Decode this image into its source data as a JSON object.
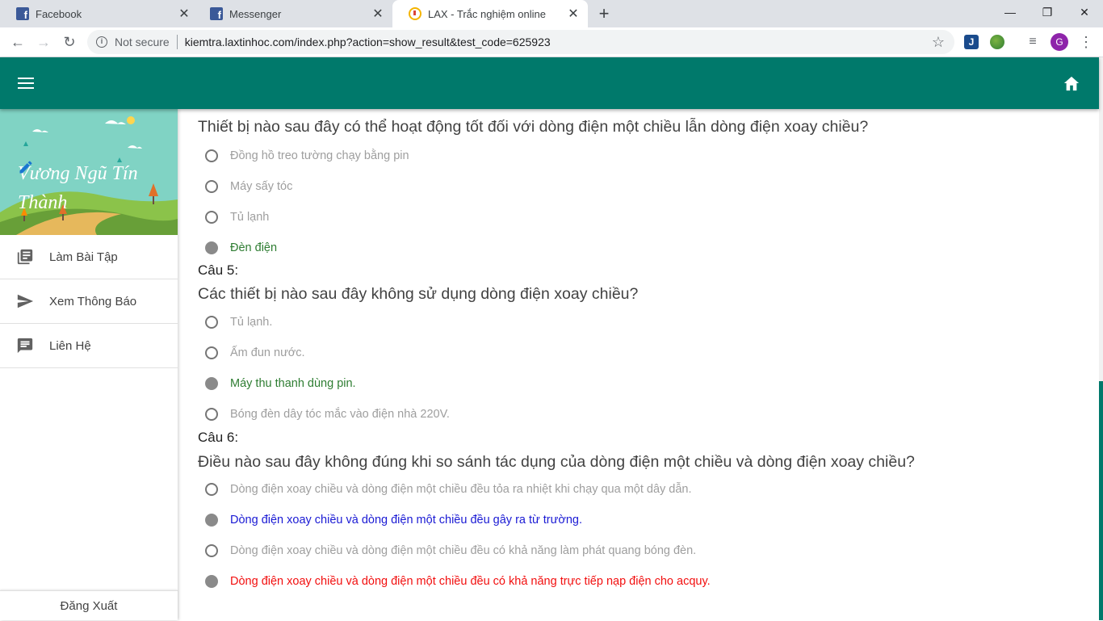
{
  "browser": {
    "tabs": [
      {
        "title": "Facebook",
        "icon": "facebook-icon"
      },
      {
        "title": "Messenger",
        "icon": "facebook-icon"
      },
      {
        "title": "LAX - Trắc nghiệm online",
        "icon": "lax-icon"
      }
    ],
    "security_label": "Not secure",
    "url": "kiemtra.laxtinhoc.com/index.php?action=show_result&test_code=625923",
    "avatar_letter": "G",
    "extension_j": "J"
  },
  "sidebar": {
    "user_name": "Vương Ngũ Tín Thành",
    "items": [
      {
        "label": "Làm Bài Tập",
        "icon": "library-books-icon"
      },
      {
        "label": "Xem Thông Báo",
        "icon": "send-icon"
      },
      {
        "label": "Liên Hệ",
        "icon": "chat-icon"
      }
    ],
    "logout_label": "Đăng Xuất"
  },
  "questions": [
    {
      "label": "",
      "text": "Thiết bị nào sau đây có thể hoạt động tốt đối với dòng điện một chiều lẫn dòng điện xoay chiều?",
      "options": [
        {
          "text": "Đồng hồ treo tường chạy bằng pin",
          "state": "unselected"
        },
        {
          "text": "Máy sấy tóc",
          "state": "unselected"
        },
        {
          "text": "Tủ lạnh",
          "state": "unselected"
        },
        {
          "text": "Đèn điện",
          "state": "correct"
        }
      ]
    },
    {
      "label": "Câu 5:",
      "text": "Các thiết bị nào sau đây không sử dụng dòng điện xoay chiều?",
      "options": [
        {
          "text": "Tủ lạnh.",
          "state": "unselected"
        },
        {
          "text": "Ấm đun nước.",
          "state": "unselected"
        },
        {
          "text": "Máy thu thanh dùng pin.",
          "state": "correct"
        },
        {
          "text": "Bóng đèn dây tóc mắc vào điện nhà 220V.",
          "state": "unselected"
        }
      ]
    },
    {
      "label": "Câu 6:",
      "text": "Điều nào sau đây không đúng khi so sánh tác dụng của dòng điện một chiều và dòng điện xoay chiều?",
      "options": [
        {
          "text": "Dòng điện xoay chiều và dòng điện một chiều đều tỏa ra nhiệt khi chạy qua một dây dẫn.",
          "state": "unselected"
        },
        {
          "text": "Dòng điện xoay chiều và dòng điện một chiều đều gây ra từ trường.",
          "state": "blue"
        },
        {
          "text": "Dòng điện xoay chiều và dòng điện một chiều đều có khả năng làm phát quang bóng đèn.",
          "state": "unselected"
        },
        {
          "text": "Dòng điện xoay chiều và dòng điện một chiều đều có khả năng trực tiếp nạp điện cho acquy.",
          "state": "red"
        }
      ]
    }
  ],
  "colors": {
    "primary": "#00796b",
    "correct": "#2e7d32",
    "blue_answer": "#1a1ad4",
    "wrong": "#f20f0f"
  }
}
